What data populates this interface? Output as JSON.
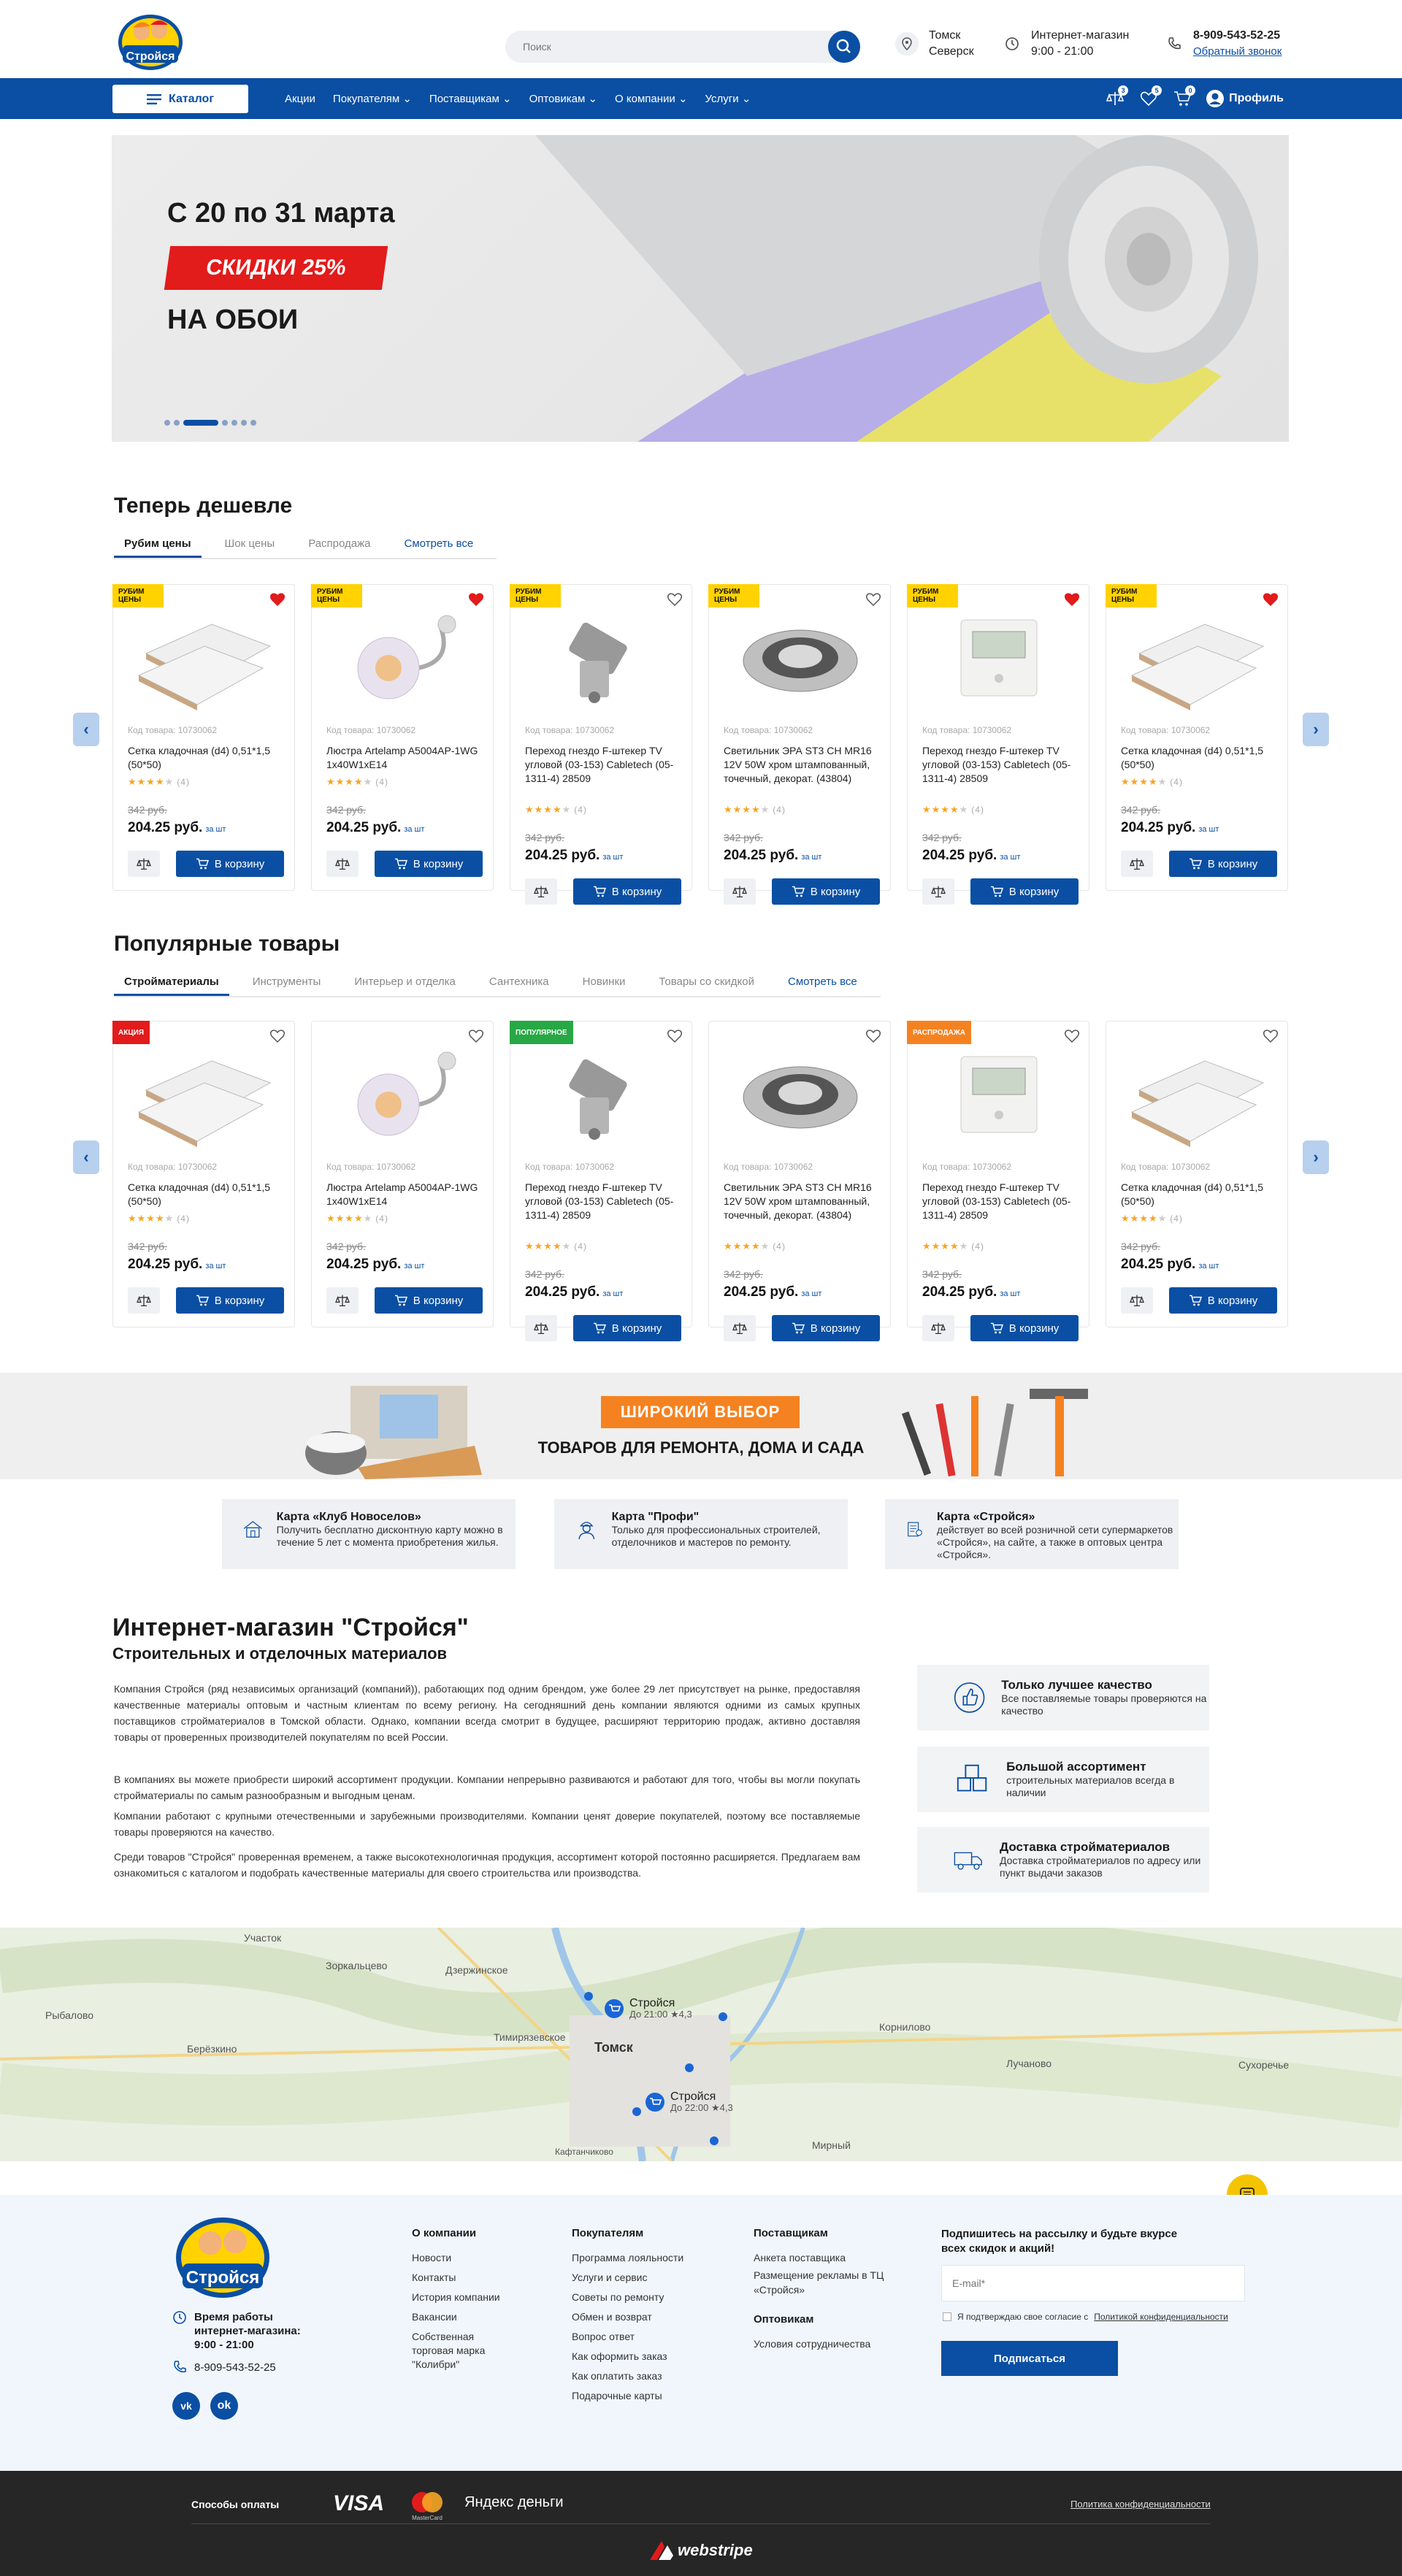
{
  "header": {
    "search_placeholder": "Поиск",
    "city1": "Томск",
    "city2": "Северск",
    "shop_title": "Интернет-магазин",
    "shop_hours": "9:00 - 21:00",
    "phone": "8-909-543-52-25",
    "callback": "Обратный звонок",
    "logo_text": "Стройся"
  },
  "nav": {
    "catalog": "Каталог",
    "items": [
      "Акции",
      "Покупателям",
      "Поставщикам",
      "Оптовикам",
      "О компании",
      "Услуги"
    ],
    "profile": "Профиль",
    "badges": [
      "3",
      "5",
      "0"
    ]
  },
  "hero": {
    "line1": "С 20 по 31 марта",
    "discount": "СКИДКИ 25%",
    "line2": "НА ОБОИ"
  },
  "sections": {
    "cheaper": {
      "title": "Теперь дешевле",
      "tabs": [
        "Рубим цены",
        "Шок цены",
        "Распродажа"
      ],
      "more": "Смотреть все"
    },
    "popular": {
      "title": "Популярные товары",
      "tabs": [
        "Стройматериалы",
        "Инструменты",
        "Интерьер и отделка",
        "Сантехника",
        "Новинки",
        "Товары со скидкой"
      ],
      "more": "Смотреть все"
    }
  },
  "labels": {
    "rubim": "РУБИМ ЦЕНЫ",
    "akciya": "АКЦИЯ",
    "popular": "ПОПУЛЯРНОЕ",
    "sale": "РАСПРОДАЖА"
  },
  "product_common": {
    "code": "Код товара: 10730062",
    "old": "342 руб.",
    "price": "204.25 руб.",
    "unit": "за шт",
    "cart": "В корзину",
    "reviews": "(4)"
  },
  "products": [
    {
      "name": "Сетка кладочная (d4) 0,51*1,5 (50*50)"
    },
    {
      "name": "Люстра Artelamp A5004AP-1WG 1x40W1xE14"
    },
    {
      "name": "Переход гнездо F-штекер TV угловой (03-153) Cabletech (05-1311-4) 28509"
    },
    {
      "name": "Светильник ЭРА ST3 CH MR16 12V 50W хром штампованный, точечный, декорат. (43804)"
    },
    {
      "name": "Переход гнездо F-штекер TV угловой (03-153) Cabletech (05-1311-4) 28509"
    },
    {
      "name": "Сетка кладочная (d4) 0,51*1,5 (50*50)"
    }
  ],
  "banner2": {
    "tag": "ШИРОКИЙ ВЫБОР",
    "text": "ТОВАРОВ ДЛЯ РЕМОНТА, ДОМА И САДА"
  },
  "promos": [
    {
      "title": "Карта «Клуб Новоселов»",
      "desc": "Получить бесплатно дисконтную карту можно в течение 5 лет с момента приобретения жилья."
    },
    {
      "title": "Карта \"Профи\"",
      "desc": "Только для профессиональных строителей, отделочников и мастеров по ремонту."
    },
    {
      "title": "Карта «Стройся»",
      "desc": "действует во всей розничной сети супермаркетов «Стройся», на сайте, а также в оптовых центра «Стройся»."
    }
  ],
  "about": {
    "title": "Интернет-магазин \"Стройся\"",
    "subtitle": "Строительных и отделочных материалов",
    "p1": "Компания Стройся (ряд независимых организаций (компаний)), работающих под одним брендом, уже более  29 лет присутствует на рынке, предоставляя качественные материалы оптовым и частным клиентам по всему региону.  На сегодняшний день компании  являются  одними из самых крупных поставщиков стройматериалов в Томской области. Однако, компании всегда смотрит в будущее, расширяют территорию продаж,  активно доставляя товары от проверенных производителей покупателям по всей России.",
    "p2": "В компаниях  вы можете приобрести широкий ассортимент продукции. Компании непрерывно развиваются и работают для того, чтобы вы могли покупать стройматериалы по самым разнообразным и выгодным ценам.",
    "p3": "Компании работают с крупными отечественными и зарубежными производителями. Компании ценят доверие покупателей, поэтому все поставляемые товары проверяются на качество.",
    "p4": "Среди товаров \"Стройся\" проверенная временем, а также высокотехнологичная продукция, ассортимент которой постоянно расширяется. Предлагаем вам ознакомиться с каталогом и подобрать качественные материалы для своего строительства или производства."
  },
  "features": [
    {
      "title": "Только лучшее качество",
      "desc": "Все поставляемые товары проверяются на качество"
    },
    {
      "title": "Большой ассортимент",
      "desc": "строительных материалов всегда в наличии"
    },
    {
      "title": "Доставка стройматериалов",
      "desc": "Доставка стройматериалов по адресу или  пункт выдачи заказов"
    }
  ],
  "map": {
    "labels": [
      "Участок",
      "Зоркальцево",
      "Дзержинское",
      "Рыбалово",
      "Берёзкино",
      "Тимирязевское",
      "Томск",
      "Корнилово",
      "Лучаново",
      "Сухоречье",
      "Мирный",
      "Кафтанчиково"
    ],
    "pin1": {
      "name": "Стройся",
      "info": "До 21:00",
      "rating": "4,3"
    },
    "pin2": {
      "name": "Стройся",
      "info": "До 22:00",
      "rating": "4,3"
    }
  },
  "footer": {
    "hours_label": "Время работы интернет-магазина:",
    "hours": "9:00 - 21:00",
    "phone": "8-909-543-52-25",
    "cols": [
      {
        "title": "О компании",
        "links": [
          "Новости",
          "Контакты",
          "История компании",
          "Вакансии",
          "Собственная торговая марка \"Колибри\""
        ]
      },
      {
        "title": "Покупателям",
        "links": [
          "Программа лояльности",
          "Услуги и сервис",
          "Советы по ремонту",
          "Обмен и возврат",
          "Вопрос ответ",
          "Как оформить заказ",
          "Как оплатить заказ",
          "Подарочные карты"
        ]
      },
      {
        "title": "Поставщикам",
        "links": [
          "Анкета поставщика",
          "Размещение рекламы в ТЦ «Стройся»"
        ]
      },
      {
        "title": "Оптовикам",
        "links": [
          "Условия сотрудничества"
        ]
      }
    ],
    "subscribe_title": "Подпишитесь на рассылку и будьте  вкурсе всех скидок и акций!",
    "email_placeholder": "E-mail*",
    "agree": "Я подтверждаю свое согласие с",
    "agree_link": "Политикой конфиденциальности",
    "subscribe_btn": "Подписаться",
    "pay_label": "Способы оплаты",
    "pay_visa": "VISA",
    "pay_mc": "MasterCard",
    "pay_yandex": "Яндекс деньги",
    "policy": "Политика конфиденциальности",
    "dev": "webstripe"
  },
  "colors": {
    "primary": "#0a4fa3",
    "accent": "#f58220",
    "red": "#e21b1b",
    "yellow": "#ffd200"
  }
}
